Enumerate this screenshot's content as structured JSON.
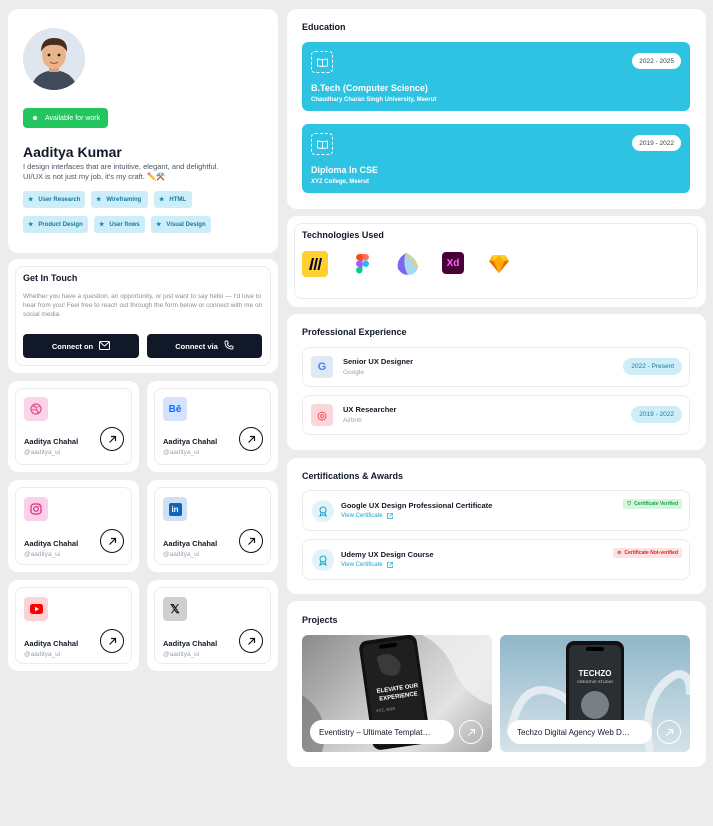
{
  "profile": {
    "available_label": "Available for work",
    "name": "Aaditya Kumar",
    "bio": "I design interfaces that are intuitive, elegant, and delightful. UI/UX is not just my job, it's my craft. ✏️⚒️",
    "tags": [
      "User Research",
      "Wireframing",
      "HTML",
      "Product Design",
      "User flows",
      "Visual Design"
    ]
  },
  "contact": {
    "title": "Get In Touch",
    "text": "Whether you have a question, an opportunity, or just want to say hello — I'd love to hear from you! Feel free to reach out through the form below or connect with me on social media.",
    "connect_on": "Connect on",
    "connect_via": "Connect via"
  },
  "socials": [
    {
      "icon": "dribbble-icon",
      "name": "Aaditya Chahal",
      "handle": "@aaditya_ui",
      "color": "#ea4c89"
    },
    {
      "icon": "behance-icon",
      "name": "Aaditya Chahal",
      "handle": "@aaditya_ui",
      "color": "#1769ff",
      "glyph": "Bē"
    },
    {
      "icon": "instagram-icon",
      "name": "Aaditya Chahal",
      "handle": "@aaditya_ui",
      "color": "#d62976"
    },
    {
      "icon": "linkedin-icon",
      "name": "Aaditya Chahal",
      "handle": "@aaditya_ui",
      "color": "#0a66c2",
      "glyph": "in"
    },
    {
      "icon": "youtube-icon",
      "name": "Aaditya Chahal",
      "handle": "@aaditya_ui",
      "color": "#ff0000"
    },
    {
      "icon": "x-icon",
      "name": "Aaditya Chahal",
      "handle": "@aaditya_ui",
      "color": "#111111",
      "glyph": "𝕏"
    }
  ],
  "education": {
    "title": "Education",
    "items": [
      {
        "degree": "B.Tech (Computer Science)",
        "school": "Chaudhary Charan Singh University, Meerut",
        "years": "2022 - 2025"
      },
      {
        "degree": "Diploma In CSE",
        "school": "XYZ College, Meerut",
        "years": "2019 - 2022"
      }
    ]
  },
  "technologies": {
    "title": "Technologies Used",
    "items": [
      "miro-icon",
      "figma-icon",
      "framer-icon",
      "adobe-xd-icon",
      "sketch-icon"
    ],
    "xd_glyph": "Xd"
  },
  "experience": {
    "title": "Professional Experience",
    "items": [
      {
        "role": "Senior UX Designer",
        "company": "Google",
        "years": "2022 - Present",
        "logo": "google-icon",
        "glyph": "G"
      },
      {
        "role": "UX Researcher",
        "company": "Airbnb",
        "years": "2019 - 2022",
        "logo": "airbnb-icon",
        "glyph": "◎"
      }
    ]
  },
  "certifications": {
    "title": "Certifications & Awards",
    "items": [
      {
        "name": "Google UX Design Professional Certificate",
        "link": "View Certificate",
        "badge": "Certificate Verified",
        "verified": true
      },
      {
        "name": "Udemy UX Design Course",
        "link": "View Certificate",
        "badge": "Certificate Not-verified",
        "verified": false
      }
    ]
  },
  "projects": {
    "title": "Projects",
    "items": [
      {
        "label": "Eventistry – Ultimate Templat…",
        "screen_text": "ELEVATE OUR EXPERIENCE",
        "screen_sub": "XYZ, 2025"
      },
      {
        "label": "Techzo Digital Agency Web D…",
        "screen_text": "TECHZO",
        "screen_sub": "CREATIVE STUDIO"
      }
    ]
  },
  "colors": {
    "accent": "#2fc3e3",
    "available": "#22c55e",
    "dark": "#111827"
  }
}
